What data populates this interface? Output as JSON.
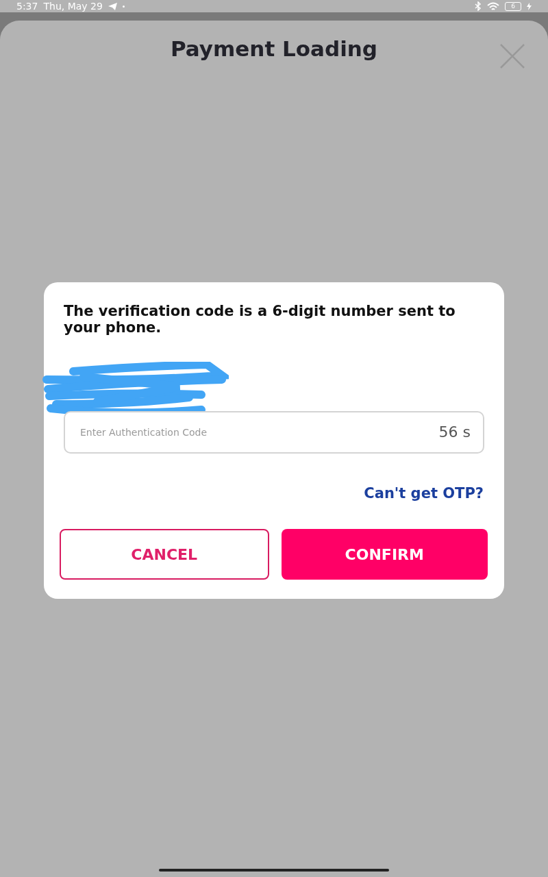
{
  "status_bar": {
    "time": "5:37",
    "date": "Thu, May 29",
    "battery": "6",
    "charging": true
  },
  "sheet": {
    "title": "Payment Loading"
  },
  "dialog": {
    "message": "The verification code is a 6-digit number sent to your phone.",
    "field": {
      "placeholder": "Enter Authentication Code",
      "timer": "56 s"
    },
    "link": "Can't get OTP?",
    "buttons": [
      {
        "label": "CANCEL",
        "kind": "outline"
      },
      {
        "label": "CONFIRM",
        "kind": "filled"
      }
    ]
  }
}
